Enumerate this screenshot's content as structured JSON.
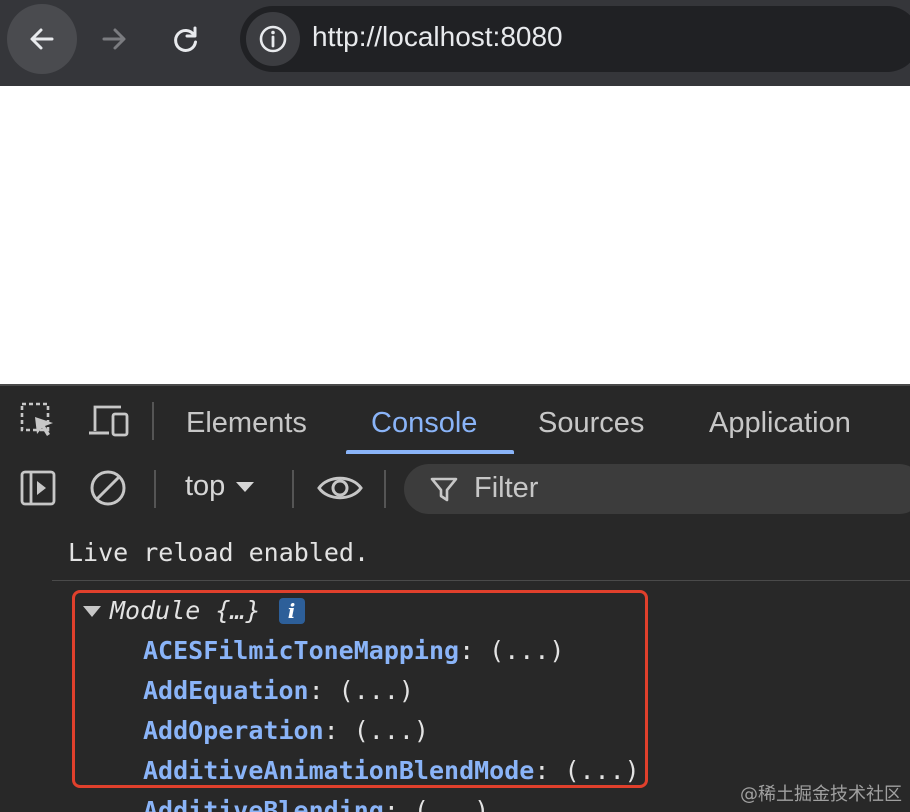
{
  "browser": {
    "url": "http://localhost:8080"
  },
  "devtools": {
    "tabs": [
      "Elements",
      "Console",
      "Sources",
      "Application"
    ],
    "active_tab": "Console",
    "context": "top",
    "filter_placeholder": "Filter"
  },
  "console": {
    "messages": [
      "Live reload enabled."
    ],
    "module": {
      "label": "Module {…}",
      "badge": "i",
      "properties": [
        {
          "key": "ACESFilmicToneMapping",
          "value": ": (...)"
        },
        {
          "key": "AddEquation",
          "value": ": (...)"
        },
        {
          "key": "AddOperation",
          "value": ": (...)"
        },
        {
          "key": "AdditiveAnimationBlendMode",
          "value": ": (...)"
        },
        {
          "key": "AdditiveBlending",
          "value": ": (...)"
        }
      ]
    }
  },
  "watermark": "@稀土掘金技术社区",
  "colors": {
    "accent": "#8ab4f8",
    "highlight": "#e0402c"
  }
}
